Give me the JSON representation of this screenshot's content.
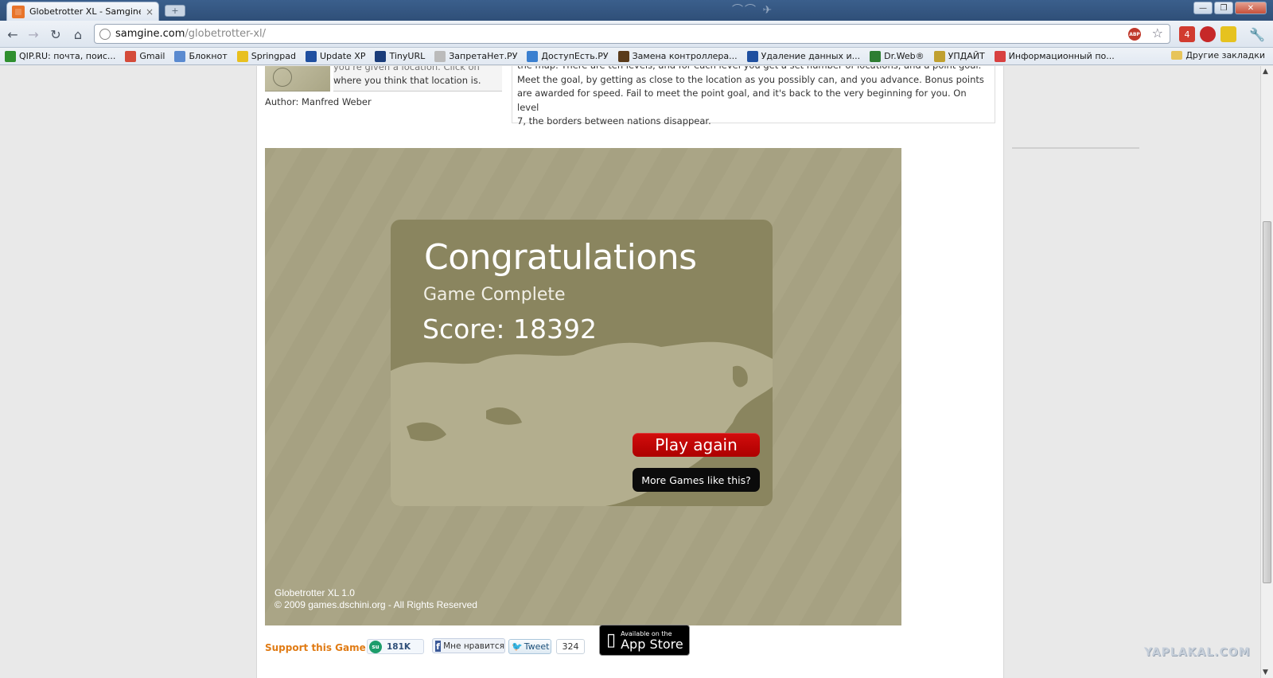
{
  "browser": {
    "tab_title": "Globetrotter XL - Samgine.…",
    "tab_close": "×",
    "new_tab": "+",
    "url_host": "samgine.com",
    "url_path": "/globetrotter-xl/",
    "abp_label": "ABP",
    "mail_count": "4"
  },
  "bookmarks": [
    {
      "label": "QIP.RU: почта, поис...",
      "color": "#2f8f2f"
    },
    {
      "label": "Gmail",
      "color": "#d44b3a"
    },
    {
      "label": "Блокнот",
      "color": "#5a8ad0"
    },
    {
      "label": "Springpad",
      "color": "#e8c020"
    },
    {
      "label": "Update XP",
      "color": "#1f4fa0"
    },
    {
      "label": "TinyURL",
      "color": "#1a3c7a"
    },
    {
      "label": "ЗапретаНет.РУ",
      "color": "#bbbbbb"
    },
    {
      "label": "ДоступЕсть.РУ",
      "color": "#3a7fd0"
    },
    {
      "label": "Замена контроллера...",
      "color": "#5a3b1b"
    },
    {
      "label": "Удаление данных и...",
      "color": "#2050a0"
    },
    {
      "label": "Dr.Web®",
      "color": "#2e7d32"
    },
    {
      "label": "УПДАЙТ",
      "color": "#c0a030"
    },
    {
      "label": "Информационный по...",
      "color": "#d84040"
    }
  ],
  "bookmarks_other": "Другие закладки",
  "description": {
    "left_cut": "you're given a location. Click on",
    "left_line": "where you think that location is.",
    "author": "Author: Manfred Weber",
    "right_lines": [
      "the map. There are ten levels, and for each level you get a set number of locations, and a point goal.",
      "Meet the goal, by getting as close to the location as you possibly can, and you advance. Bonus points",
      "are awarded for speed. Fail to meet the point goal, and it's back to the very beginning for you. On level",
      "7, the borders between nations disappear."
    ]
  },
  "game": {
    "heading": "Congratulations",
    "subtitle": "Game Complete",
    "score_label": "Score: 18392",
    "play_again": "Play again",
    "more_games": "More Games like this?",
    "version": "Globetrotter XL 1.0",
    "copyright": "© 2009 games.dschini.org - All Rights Reserved"
  },
  "support": {
    "label": "Support this Game:",
    "stumble_count": "181K",
    "facebook_label": "Мне нравится",
    "tweet_label": "Tweet",
    "tweet_count": "324",
    "appstore_small": "Available on the",
    "appstore_big": "App Store"
  },
  "watermark": "YAPLAKAL.COM",
  "colors": {
    "play_again": "#c80000",
    "support_label": "#e07b14",
    "card": "#8a855f",
    "game_bg": "#a8a385"
  }
}
